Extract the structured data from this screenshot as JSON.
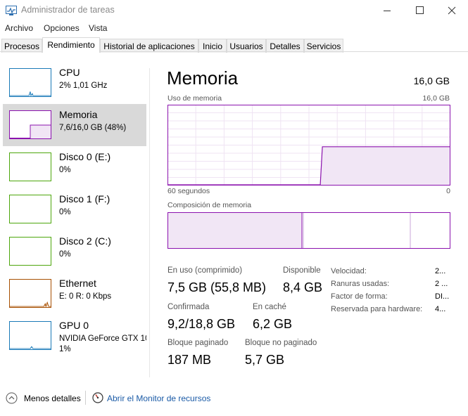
{
  "window": {
    "title": "Administrador de tareas"
  },
  "menu": [
    "Archivo",
    "Opciones",
    "Vista"
  ],
  "tabs": [
    "Procesos",
    "Rendimiento",
    "Historial de aplicaciones",
    "Inicio",
    "Usuarios",
    "Detalles",
    "Servicios"
  ],
  "active_tab": "Rendimiento",
  "resources": [
    {
      "name": "CPU",
      "detail": "2%  1,01 GHz",
      "color": "#1a7ab8"
    },
    {
      "name": "Memoria",
      "detail": "7,6/16,0 GB (48%)",
      "color": "#8b12ae"
    },
    {
      "name": "Disco 0 (E:)",
      "detail": "0%",
      "color": "#4da60c"
    },
    {
      "name": "Disco 1 (F:)",
      "detail": "0%",
      "color": "#4da60c"
    },
    {
      "name": "Disco 2 (C:)",
      "detail": "0%",
      "color": "#4da60c"
    },
    {
      "name": "Ethernet",
      "detail": "E: 0 R: 0 Kbps",
      "color": "#a74f01"
    },
    {
      "name": "GPU 0",
      "detail": "NVIDIA GeForce GTX 10",
      "detail2": "1%",
      "color": "#1a7ab8"
    }
  ],
  "selected_resource": "Memoria",
  "memory": {
    "title": "Memoria",
    "total": "16,0 GB",
    "usage_label": "Uso de memoria",
    "usage_max": "16,0 GB",
    "x_left": "60 segundos",
    "x_right": "0",
    "composition_label": "Composición de memoria",
    "usage_fraction": 0.48,
    "stats": {
      "in_use_label": "En uso (comprimido)",
      "in_use_value": "7,5 GB (55,8 MB)",
      "available_label": "Disponible",
      "available_value": "8,4 GB",
      "committed_label": "Confirmada",
      "committed_value": "9,2/18,8 GB",
      "cached_label": "En caché",
      "cached_value": "6,2 GB",
      "paged_label": "Bloque paginado",
      "paged_value": "187 MB",
      "nonpaged_label": "Bloque no paginado",
      "nonpaged_value": "5,7 GB"
    },
    "properties": [
      {
        "label": "Velocidad:",
        "value": "2..."
      },
      {
        "label": "Ranuras usadas:",
        "value": "2 ..."
      },
      {
        "label": "Factor de forma:",
        "value": "DI..."
      },
      {
        "label": "Reservada para hardware:",
        "value": "4..."
      }
    ]
  },
  "footer": {
    "less_details": "Menos detalles",
    "resource_monitor": "Abrir el Monitor de recursos"
  }
}
